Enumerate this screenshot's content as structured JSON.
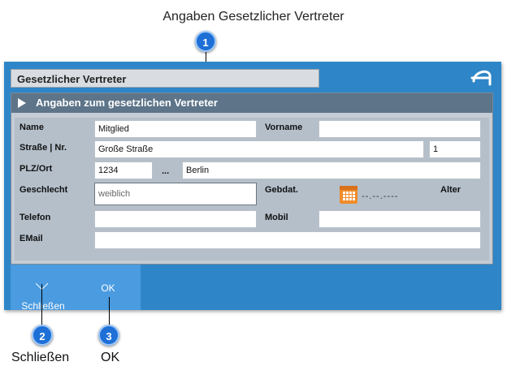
{
  "callouts": {
    "top_title": "Angaben Gesetzlicher Vertreter",
    "badge1": "1",
    "badge2": "2",
    "badge3": "3",
    "label2": "Schließen",
    "label3": "OK"
  },
  "window": {
    "title": "Gesetzlicher Vertreter",
    "section_title": "Angaben zum gesetzlichen Vertreter",
    "logo_icon": "app-logo-icon"
  },
  "form": {
    "name_label": "Name",
    "name_value": "Mitglied",
    "vorname_label": "Vorname",
    "vorname_value": "",
    "strasse_label": "Straße | Nr.",
    "strasse_value": "Große Straße",
    "nr_value": "1",
    "plz_label": "PLZ/Ort",
    "plz_value": "1234",
    "dots": "...",
    "ort_value": "Berlin",
    "geschlecht_label": "Geschlecht",
    "geschlecht_value": "weiblich",
    "gebdat_label": "Gebdat.",
    "gebdat_value": "--.--.----",
    "alter_label": "Alter",
    "telefon_label": "Telefon",
    "telefon_value": "",
    "mobil_label": "Mobil",
    "mobil_value": "",
    "email_label": "EMail",
    "email_value": ""
  },
  "buttons": {
    "close_label": "Schließen",
    "ok_label": "OK"
  },
  "colors": {
    "window_bg": "#2e86c8",
    "header_bg": "#5d7489",
    "badge": "#1e6fd6",
    "calendar": "#f08c2a"
  }
}
